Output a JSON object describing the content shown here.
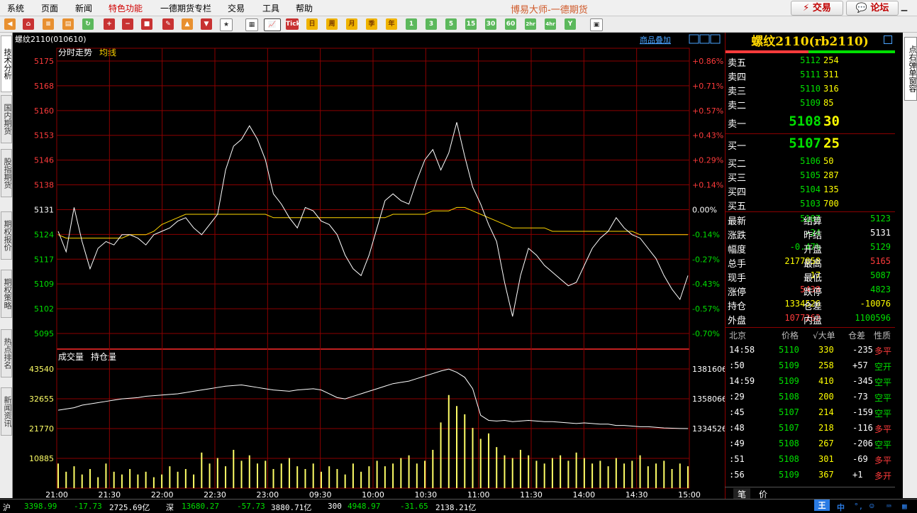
{
  "menu": {
    "items": [
      "系统",
      "页面",
      "新闻",
      "特色功能",
      "一德期货专栏",
      "交易",
      "工具",
      "帮助"
    ],
    "brand": "博易大师-一德期货",
    "trade_btn": "交易",
    "forum_btn": "论坛"
  },
  "toolbar": {
    "tick_label": "Tick",
    "day_label": "日",
    "week_label": "周",
    "month_label": "月",
    "quarter_label": "季",
    "year_label": "年",
    "minute_labels": [
      "1",
      "3",
      "5",
      "15",
      "30",
      "60",
      "2hr",
      "4hr",
      "Y"
    ]
  },
  "left_tabs": [
    "技术分析",
    "国内期货",
    "股指期货",
    "期权报价",
    "期权策略",
    "热点排名",
    "新闻资讯"
  ],
  "right_tab": "点右弹单窗容",
  "chart": {
    "header": "螺纹2110(010610)",
    "overlay_link": "商品叠加",
    "price_legend": "分时走势",
    "avg_legend": "均线",
    "vol_legend": "成交量",
    "oi_legend": "持仓量",
    "colors": {
      "up": "#ff3b3b",
      "down": "#00e000",
      "price_line": "#ffffff",
      "avg_line": "#ffd700",
      "grid": "#8b0000",
      "volume": "#ffff66"
    }
  },
  "chart_data": {
    "type": "line",
    "y_ticks": [
      "5175",
      "5168",
      "5160",
      "5153",
      "5146",
      "5138",
      "5131",
      "5124",
      "5117",
      "5109",
      "5102",
      "5095"
    ],
    "pct_ticks": [
      "+0.86%",
      "+0.71%",
      "+0.57%",
      "+0.43%",
      "+0.29%",
      "+0.14%",
      "0.00%",
      "-0.14%",
      "-0.27%",
      "-0.43%",
      "-0.57%",
      "-0.70%"
    ],
    "vol_ticks": [
      "43540",
      "32655",
      "21770",
      "10885"
    ],
    "oi_ticks": [
      "1381606",
      "1358066",
      "1334526"
    ],
    "x_ticks": [
      "21:00",
      "21:30",
      "22:00",
      "22:30",
      "23:00",
      "09:30",
      "10:00",
      "10:30",
      "11:00",
      "11:30",
      "14:00",
      "14:30",
      "15:00"
    ],
    "ylim": [
      5092,
      5175
    ],
    "prev_settle": 5131,
    "price": [
      5125,
      5119,
      5132,
      5122,
      5114,
      5120,
      5122,
      5121,
      5124,
      5124,
      5123,
      5121,
      5124,
      5125,
      5126,
      5128,
      5129,
      5126,
      5124,
      5127,
      5130,
      5143,
      5150,
      5152,
      5156,
      5152,
      5146,
      5136,
      5133,
      5129,
      5126,
      5132,
      5131,
      5128,
      5127,
      5124,
      5118,
      5114,
      5112,
      5118,
      5126,
      5134,
      5136,
      5134,
      5133,
      5140,
      5146,
      5149,
      5143,
      5148,
      5157,
      5147,
      5138,
      5133,
      5127,
      5122,
      5110,
      5100,
      5112,
      5120,
      5118,
      5115,
      5113,
      5111,
      5109,
      5110,
      5115,
      5120,
      5123,
      5125,
      5129,
      5126,
      5124,
      5123,
      5120,
      5117,
      5112,
      5108,
      5105,
      5112
    ],
    "avg": [
      5124,
      5123,
      5123,
      5123,
      5123,
      5123,
      5123,
      5123,
      5123,
      5124,
      5124,
      5124,
      5125,
      5127,
      5128,
      5129,
      5130,
      5130,
      5130,
      5130,
      5130,
      5130,
      5130,
      5130,
      5130,
      5130,
      5130,
      5129,
      5129,
      5129,
      5129,
      5129,
      5129,
      5129,
      5129,
      5129,
      5129,
      5129,
      5129,
      5129,
      5129,
      5129,
      5130,
      5130,
      5130,
      5130,
      5130,
      5131,
      5131,
      5131,
      5132,
      5132,
      5131,
      5130,
      5129,
      5128,
      5127,
      5126,
      5126,
      5126,
      5126,
      5126,
      5125,
      5125,
      5125,
      5125,
      5125,
      5125,
      5125,
      5125,
      5125,
      5125,
      5125,
      5124,
      5124,
      5124,
      5124,
      5124,
      5124,
      5124
    ],
    "volume": [
      9000,
      6000,
      8000,
      5000,
      7000,
      4000,
      9000,
      6000,
      5000,
      7000,
      5000,
      6000,
      4000,
      5000,
      8000,
      6000,
      7000,
      5000,
      13000,
      9000,
      11000,
      8000,
      14000,
      10000,
      12000,
      9000,
      10000,
      7000,
      9000,
      11000,
      8000,
      7000,
      9000,
      6000,
      8000,
      7000,
      5000,
      9000,
      6000,
      8000,
      10000,
      8000,
      9000,
      11000,
      12000,
      9000,
      10000,
      14000,
      24000,
      34000,
      30000,
      27000,
      22000,
      18000,
      20000,
      15000,
      12000,
      11000,
      14000,
      12000,
      10000,
      9000,
      11000,
      12000,
      10000,
      13000,
      11000,
      9000,
      10000,
      8000,
      11000,
      9000,
      10000,
      12000,
      8000,
      9000,
      10000,
      7000,
      9000,
      8000
    ],
    "open_interest": [
      1349000,
      1350000,
      1351000,
      1353000,
      1354000,
      1355000,
      1356000,
      1357000,
      1358000,
      1358500,
      1359000,
      1360000,
      1360500,
      1361000,
      1361500,
      1362000,
      1363000,
      1364000,
      1365000,
      1366000,
      1367000,
      1368000,
      1368500,
      1369000,
      1368000,
      1367000,
      1366000,
      1365000,
      1364500,
      1364000,
      1365000,
      1365500,
      1366000,
      1365000,
      1362000,
      1359000,
      1358000,
      1360000,
      1362000,
      1364000,
      1366000,
      1368000,
      1370000,
      1371000,
      1372000,
      1374000,
      1376000,
      1378000,
      1380000,
      1381500,
      1379000,
      1375000,
      1366000,
      1345000,
      1341000,
      1340500,
      1341000,
      1340000,
      1340500,
      1341000,
      1340500,
      1340000,
      1340000,
      1339500,
      1339000,
      1338500,
      1339000,
      1338500,
      1338000,
      1338000,
      1337000,
      1337000,
      1336500,
      1336000,
      1336000,
      1335500,
      1335000,
      1334800,
      1334600,
      1334526
    ]
  },
  "quote": {
    "title": "螺纹2110(rb2110)",
    "asks": [
      {
        "label": "卖五",
        "price": "5112",
        "vol": "254"
      },
      {
        "label": "卖四",
        "price": "5111",
        "vol": "311"
      },
      {
        "label": "卖三",
        "price": "5110",
        "vol": "316"
      },
      {
        "label": "卖二",
        "price": "5109",
        "vol": "85"
      }
    ],
    "ask1": {
      "label": "卖一",
      "price": "5108",
      "vol": "30"
    },
    "bid1": {
      "label": "买一",
      "price": "5107",
      "vol": "25"
    },
    "bids": [
      {
        "label": "买二",
        "price": "5106",
        "vol": "50"
      },
      {
        "label": "买三",
        "price": "5105",
        "vol": "287"
      },
      {
        "label": "买四",
        "price": "5104",
        "vol": "135"
      },
      {
        "label": "买五",
        "price": "5103",
        "vol": "700"
      }
    ],
    "stats": [
      {
        "l1": "最新",
        "v1": "5107",
        "c1": "#00e000",
        "l2": "结算",
        "v2": "5123",
        "c2": "#00e000"
      },
      {
        "l1": "涨跌",
        "v1": "-24",
        "c1": "#00e000",
        "l2": "昨结",
        "v2": "5131",
        "c2": "#ffffff"
      },
      {
        "l1": "幅度",
        "v1": "-0.47%",
        "c1": "#00e000",
        "l2": "开盘",
        "v2": "5129",
        "c2": "#00e000"
      },
      {
        "l1": "总手",
        "v1": "2177858",
        "c1": "#ffff00",
        "l2": "最高",
        "v2": "5165",
        "c2": "#ff3b3b"
      },
      {
        "l1": "现手",
        "v1": "17",
        "c1": "#ffff00",
        "l2": "最低",
        "v2": "5087",
        "c2": "#00e000"
      },
      {
        "l1": "涨停",
        "v1": "5438",
        "c1": "#ff3b3b",
        "l2": "跌停",
        "v2": "4823",
        "c2": "#00e000"
      },
      {
        "l1": "持仓",
        "v1": "1334526",
        "c1": "#ffff00",
        "l2": "仓差",
        "v2": "-10076",
        "c2": "#ffff00"
      },
      {
        "l1": "外盘",
        "v1": "1077262",
        "c1": "#ff3b3b",
        "l2": "内盘",
        "v2": "1100596",
        "c2": "#00e000"
      }
    ],
    "tick_header": {
      "time": "北京",
      "price": "价格",
      "vol": "√大单",
      "oi": "仓差",
      "nature": "性质"
    },
    "ticks": [
      {
        "time": "14:58",
        "price": "5110",
        "vol": "330",
        "oi": "-235",
        "nature": "多平",
        "nc": "#ff3b3b"
      },
      {
        "time": ":50",
        "price": "5109",
        "vol": "258",
        "oi": "+57",
        "nature": "空开",
        "nc": "#00e000"
      },
      {
        "time": "14:59",
        "price": "5109",
        "vol": "410",
        "oi": "-345",
        "nature": "空平",
        "nc": "#00e000"
      },
      {
        "time": ":29",
        "price": "5108",
        "vol": "200",
        "oi": "-73",
        "nature": "空平",
        "nc": "#00e000"
      },
      {
        "time": ":45",
        "price": "5107",
        "vol": "214",
        "oi": "-159",
        "nature": "空平",
        "nc": "#00e000"
      },
      {
        "time": ":48",
        "price": "5107",
        "vol": "218",
        "oi": "-116",
        "nature": "多平",
        "nc": "#ff3b3b"
      },
      {
        "time": ":49",
        "price": "5108",
        "vol": "267",
        "oi": "-206",
        "nature": "空平",
        "nc": "#00e000"
      },
      {
        "time": ":51",
        "price": "5108",
        "vol": "301",
        "oi": "-69",
        "nature": "多平",
        "nc": "#ff3b3b"
      },
      {
        "time": ":56",
        "price": "5109",
        "vol": "367",
        "oi": "+1",
        "nature": "多开",
        "nc": "#ff3b3b"
      }
    ],
    "bottom_tabs": [
      "笔",
      "价"
    ]
  },
  "status": {
    "sh_label": "沪",
    "sh_val": "3398.99",
    "sh_chg": "-17.73",
    "sh_amt": "2725.69亿",
    "sz_label": "深",
    "sz_val": "13680.27",
    "sz_chg": "-57.73",
    "sz_amt": "3880.71亿",
    "hs_label": "300",
    "hs_val": "4948.97",
    "hs_chg": "-31.65",
    "hs_amt": "2138.21亿",
    "ime": "中"
  }
}
